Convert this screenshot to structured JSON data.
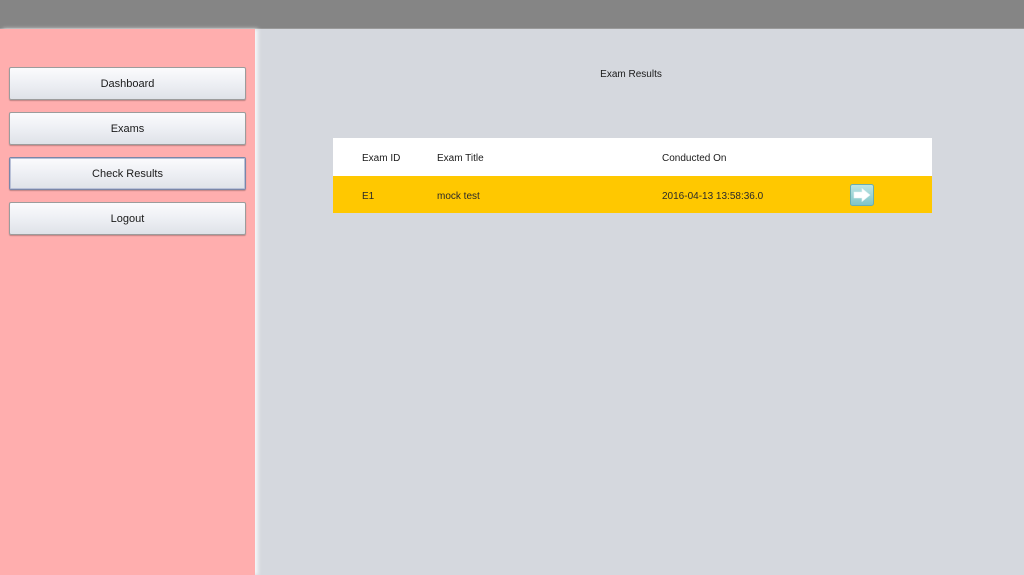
{
  "sidebar": {
    "buttons": [
      {
        "label": "Dashboard"
      },
      {
        "label": "Exams"
      },
      {
        "label": "Check Results"
      },
      {
        "label": "Logout"
      }
    ],
    "background": "#ffaeae"
  },
  "main": {
    "title": "Exam Results",
    "table": {
      "columns": [
        "Exam ID",
        "Exam Title",
        "Conducted On"
      ],
      "rows": [
        {
          "id": "E1",
          "title": "mock test",
          "conducted_on": "2016-04-13 13:58:36.0",
          "action_icon": "arrow-right-icon"
        }
      ],
      "row_highlight_color": "#ffc800"
    }
  }
}
